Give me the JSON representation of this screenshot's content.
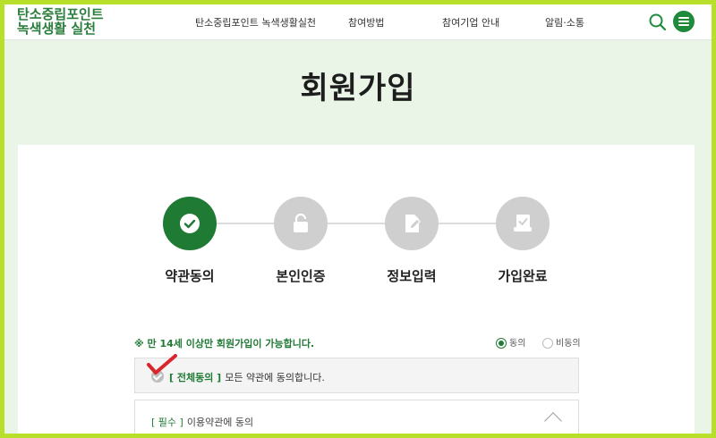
{
  "header": {
    "logo_line1": "탄소중립포인트",
    "logo_line2": "녹색생활 실천",
    "nav": [
      "탄소중립포인트 녹색생활실천",
      "참여방법",
      "참여기업 안내",
      "알림·소통"
    ]
  },
  "page_title": "회원가입",
  "steps": [
    "약관동의",
    "본인인증",
    "정보입력",
    "가입완료"
  ],
  "age_notice": "※ 만 14세 이상만 회원가입이 가능합니다.",
  "age_radio": {
    "agree": "동의",
    "disagree": "비동의",
    "selected": "agree"
  },
  "agree_all": {
    "tag": "[ 전체동의 ]",
    "text": "모든 약관에 동의합니다."
  },
  "terms_item": {
    "tag": "[ 필수 ]",
    "text": "이용약관에 동의"
  },
  "colors": {
    "primary": "#1f7a34",
    "inactive": "#cfcfcf",
    "frame": "#b8e02a",
    "accent_mark": "#d8262c"
  },
  "icons": {
    "search": "search-icon",
    "menu": "menu-icon",
    "steps": [
      "check-icon",
      "lock-icon",
      "edit-icon",
      "completed-icon"
    ]
  }
}
